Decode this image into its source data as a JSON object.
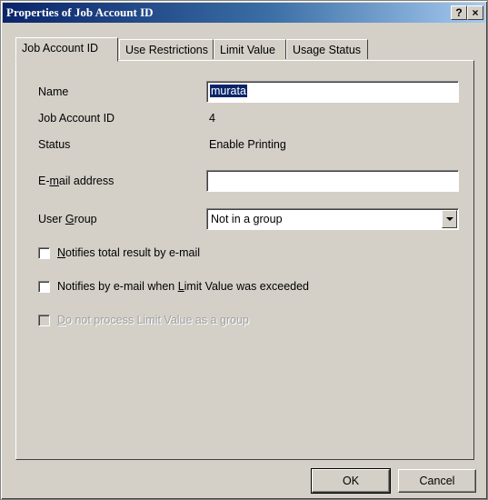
{
  "window": {
    "title": "Properties of Job Account ID",
    "help_label": "?",
    "close_label": "×"
  },
  "tabs": [
    {
      "label": "Job Account ID",
      "active": true
    },
    {
      "label": "Use Restrictions",
      "active": false
    },
    {
      "label": "Limit Value",
      "active": false
    },
    {
      "label": "Usage Status",
      "active": false
    }
  ],
  "form": {
    "name_label": "Name",
    "name_value": "murata",
    "job_account_id_label": "Job Account ID",
    "job_account_id_value": "4",
    "status_label": "Status",
    "status_value": "Enable Printing",
    "email_label_pre": "E-",
    "email_label_u": "m",
    "email_label_post": "ail address",
    "email_value": "",
    "user_group_label_pre": "User ",
    "user_group_label_u": "G",
    "user_group_label_post": "roup",
    "user_group_value": "Not in a group"
  },
  "checkboxes": [
    {
      "pre": "",
      "u": "N",
      "post": "otifies total result by e-mail",
      "checked": false,
      "enabled": true
    },
    {
      "pre": "Notifies by e-mail when ",
      "u": "L",
      "post": "imit Value was exceeded",
      "checked": false,
      "enabled": true
    },
    {
      "pre": "",
      "u": "D",
      "post": "o not process Limit Value as a group",
      "checked": false,
      "enabled": false
    }
  ],
  "buttons": {
    "ok": "OK",
    "cancel": "Cancel"
  },
  "colors": {
    "titlebar_start": "#0a246a",
    "titlebar_end": "#a6caf0",
    "face": "#d4d0c8",
    "selection": "#0a246a"
  }
}
